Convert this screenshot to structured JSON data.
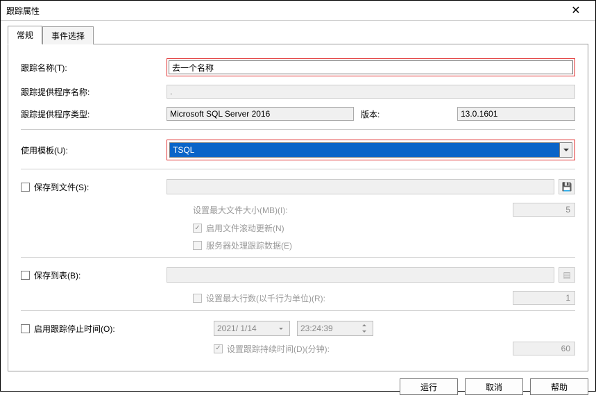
{
  "window": {
    "title": "跟踪属性"
  },
  "tabs": {
    "general": "常规",
    "events": "事件选择"
  },
  "general": {
    "trace_name_label": "跟踪名称(T):",
    "trace_name_value": "去一个名称",
    "provider_name_label": "跟踪提供程序名称:",
    "provider_name_value": ".",
    "provider_type_label": "跟踪提供程序类型:",
    "provider_type_value": "Microsoft SQL Server 2016",
    "version_label": "版本:",
    "version_value": "13.0.1601",
    "use_template_label": "使用模板(U):",
    "use_template_value": "TSQL",
    "save_file_label": "保存到文件(S):",
    "max_file_size_label": "设置最大文件大小(MB)(I):",
    "max_file_size_value": "5",
    "rollover_label": "启用文件滚动更新(N)",
    "server_process_label": "服务器处理跟踪数据(E)",
    "save_table_label": "保存到表(B):",
    "max_rows_label": "设置最大行数(以千行为单位)(R):",
    "max_rows_value": "1",
    "enable_stop_label": "启用跟踪停止时间(O):",
    "stop_date_value": "2021/ 1/14",
    "stop_time_value": "23:24:39",
    "duration_label": "设置跟踪持续时间(D)(分钟):",
    "duration_value": "60"
  },
  "buttons": {
    "run": "运行",
    "cancel": "取消",
    "help": "帮助"
  }
}
